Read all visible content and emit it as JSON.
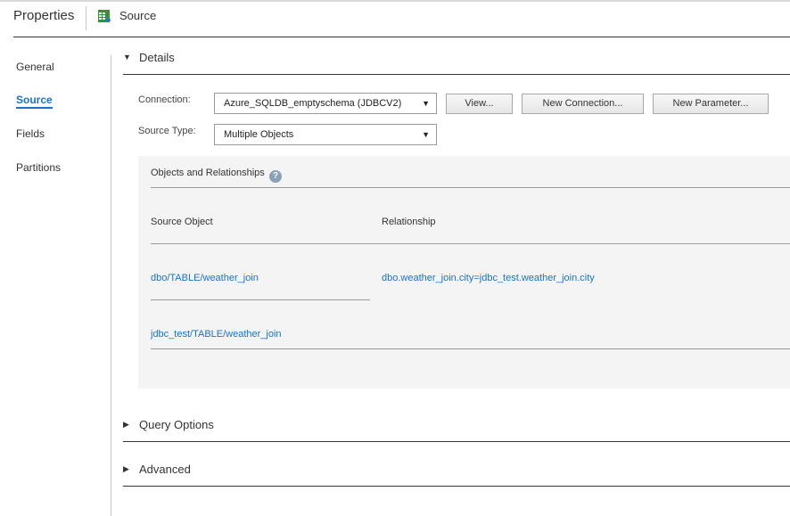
{
  "header": {
    "title": "Properties",
    "source_label": "Source"
  },
  "nav": {
    "items": [
      {
        "label": "General"
      },
      {
        "label": "Source",
        "active": true
      },
      {
        "label": "Fields"
      },
      {
        "label": "Partitions"
      }
    ]
  },
  "details": {
    "title": "Details",
    "connection_label": "Connection:",
    "connection_value": "Azure_SQLDB_emptyschema (JDBCV2)",
    "source_type_label": "Source Type:",
    "source_type_value": "Multiple Objects",
    "buttons": {
      "view": "View...",
      "new_connection": "New Connection...",
      "new_parameter": "New Parameter..."
    }
  },
  "relationships": {
    "title": "Objects and Relationships",
    "help": "?",
    "columns": [
      "Source Object",
      "Relationship"
    ],
    "rows": [
      {
        "source_object": "dbo/TABLE/weather_join",
        "relationship": "dbo.weather_join.city=jdbc_test.weather_join.city"
      },
      {
        "source_object": "jdbc_test/TABLE/weather_join",
        "relationship": ""
      }
    ]
  },
  "sections": {
    "query_options": "Query Options",
    "advanced": "Advanced"
  },
  "colors": {
    "accent": "#1a73c8",
    "panel_bg": "#f4f4f4",
    "rule": "#333333"
  },
  "icons": {
    "source": "table-grid-icon",
    "help": "help-circle-icon",
    "expanded": "caret-down-icon",
    "collapsed": "caret-right-icon",
    "dropdown": "dropdown-arrow-icon"
  }
}
